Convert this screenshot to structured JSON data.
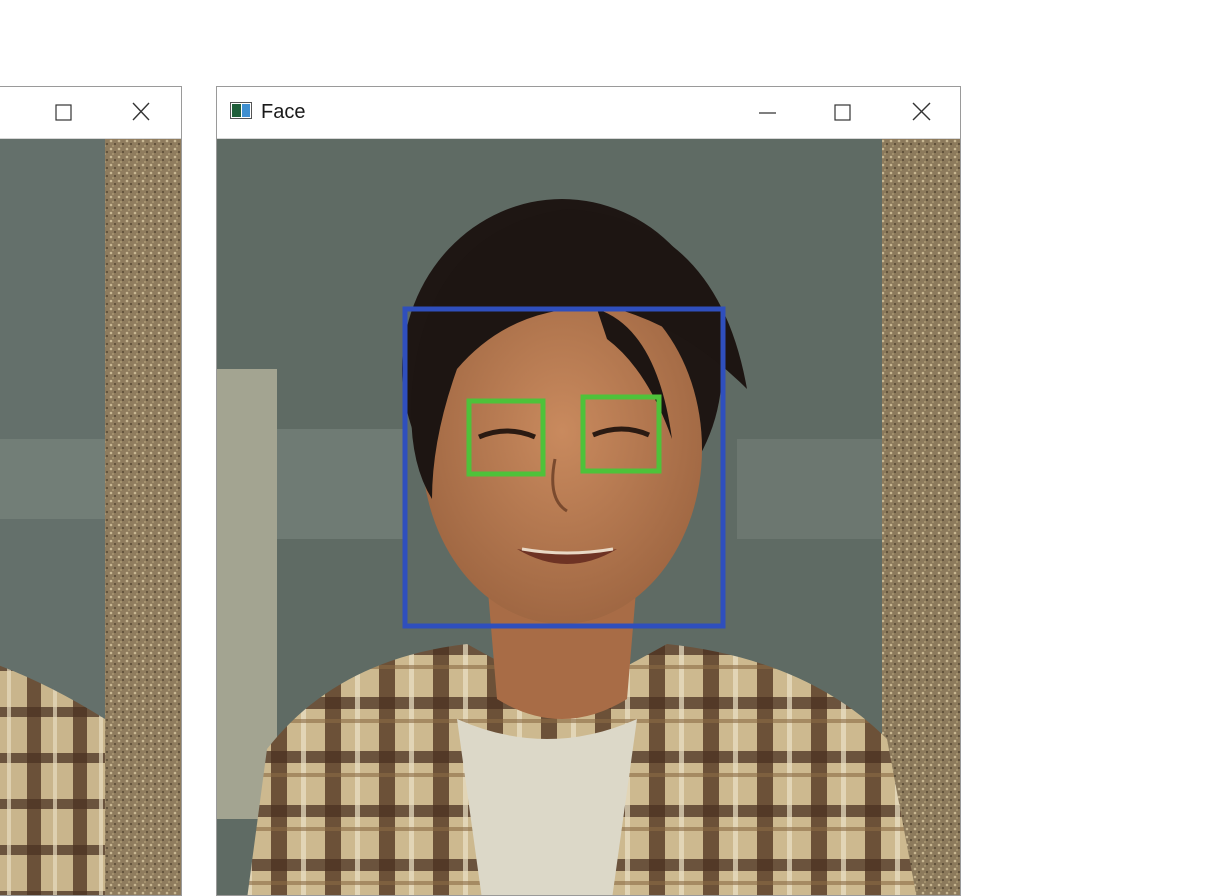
{
  "windows": {
    "face": {
      "title": "Face",
      "icon": "opencv-window-icon",
      "controls": [
        "minimize-icon",
        "maximize-icon",
        "close-icon"
      ]
    },
    "left": {
      "title": "",
      "controls": [
        "maximize-icon",
        "close-icon"
      ]
    }
  },
  "detections": {
    "face_box_color": "#2f4fbd",
    "eye_box_color": "#4ec23a"
  }
}
